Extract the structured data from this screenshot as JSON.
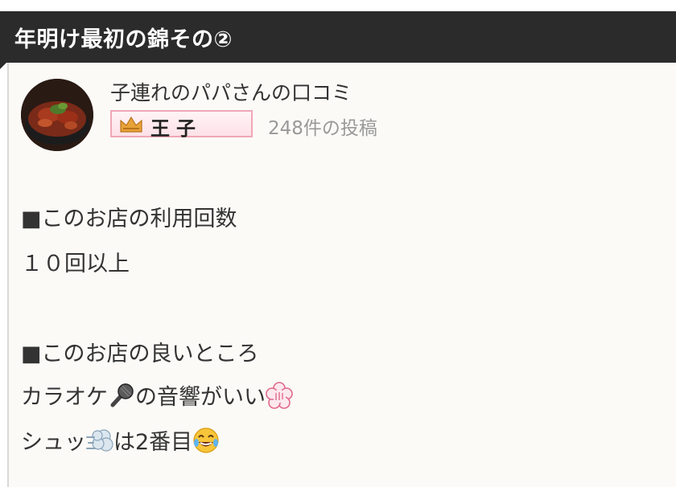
{
  "review": {
    "title": "年明け最初の錦その②",
    "reviewer": {
      "name": "子連れのパパさんの口コミ",
      "rank_label": "王子",
      "post_count": "248件の投稿"
    },
    "sections": [
      {
        "heading": "■このお店の利用回数",
        "lines": [
          {
            "text": "１０回以上"
          }
        ]
      },
      {
        "heading": "■このお店の良いところ",
        "lines": [
          {
            "before": "カラオケ",
            "icon": "microphone-emoji",
            "after": "の音響がいい",
            "icon2": "flower-stamp-emoji"
          },
          {
            "before": "シュッ",
            "icon": "dash-emoji",
            "after": "は2番目",
            "icon2": "tears-of-joy-emoji"
          }
        ]
      }
    ]
  },
  "colors": {
    "title_bar": "#2b2b2b",
    "badge_border": "#f1a7b7",
    "muted_text": "#999999"
  }
}
